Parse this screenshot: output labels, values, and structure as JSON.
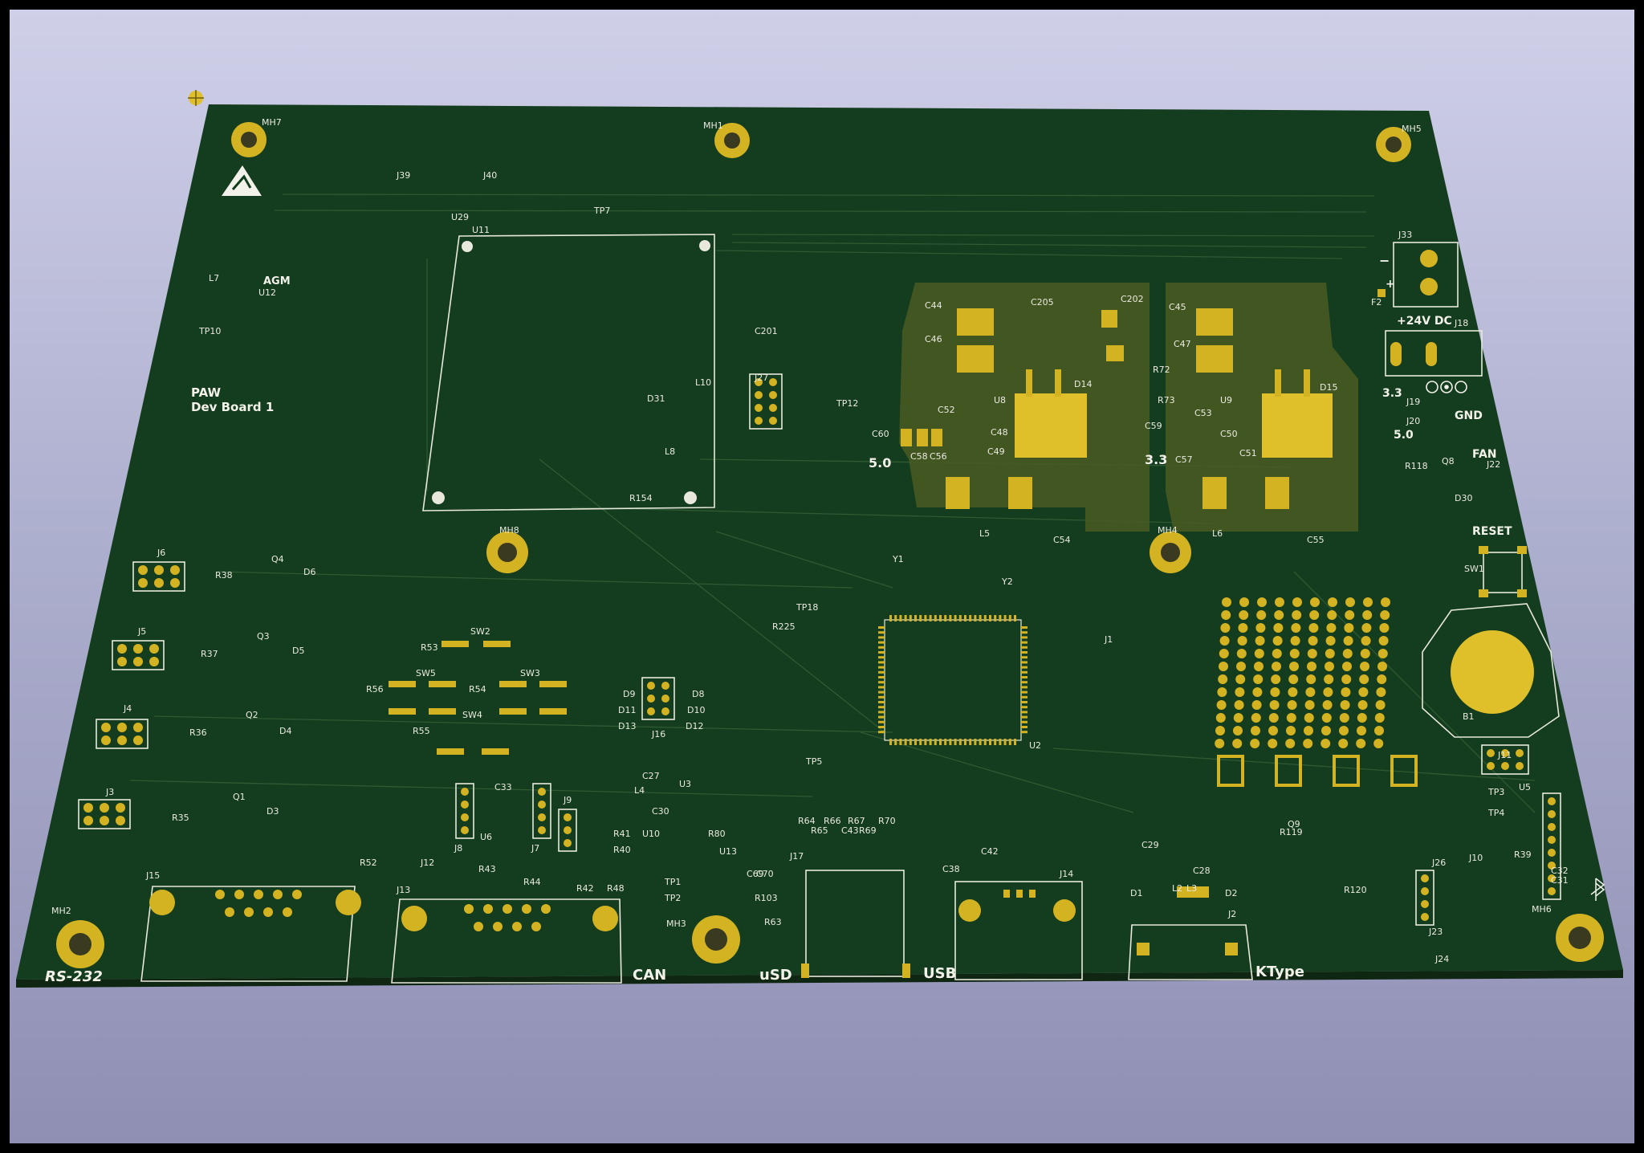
{
  "board": {
    "title": "PAW",
    "subtitle": "Dev Board 1",
    "colors": {
      "solder_mask": "#143c1e",
      "copper_pad": "#d4b323",
      "silkscreen": "#f2f2ea",
      "background_top": "#cfcfe8",
      "background_bottom": "#8f8fb4"
    }
  },
  "edge_labels": {
    "rs232": "RS-232",
    "can": "CAN",
    "usd": "uSD",
    "usb": "USB",
    "ktype": "KType"
  },
  "side_labels": {
    "power_in": "+24V DC",
    "minus": "−",
    "plus": "+",
    "v33": "3.3",
    "gnd": "GND",
    "v50": "5.0",
    "fan": "FAN",
    "reset": "RESET",
    "rail_50": "5.0",
    "rail_33": "3.3",
    "agm": "AGM"
  },
  "mounting_holes": [
    "MH7",
    "MH1",
    "MH5",
    "MH8",
    "MH4",
    "MH2",
    "MH3",
    "MH6"
  ],
  "connectors": [
    "J15",
    "J13",
    "J12",
    "J17",
    "J14",
    "J2",
    "J23",
    "J24",
    "J26",
    "J10",
    "J11",
    "J3",
    "J4",
    "J5",
    "J6",
    "J8",
    "J7",
    "J9",
    "J16",
    "J27",
    "J33",
    "J18",
    "J19",
    "J20",
    "J22",
    "J1",
    "J39",
    "J40"
  ],
  "ics": [
    "U11",
    "U2",
    "U3",
    "U5",
    "U6",
    "U8",
    "U9",
    "U10",
    "U12",
    "U13",
    "U29",
    "B1"
  ],
  "switches": [
    "SW1",
    "SW2",
    "SW3",
    "SW4",
    "SW5"
  ],
  "inductors": [
    "L5",
    "L6",
    "L2",
    "L3",
    "L4",
    "L7",
    "L8",
    "L10"
  ],
  "diodes": [
    "D1",
    "D2",
    "D3",
    "D4",
    "D5",
    "D6",
    "D8",
    "D9",
    "D10",
    "D11",
    "D12",
    "D13",
    "D14",
    "D15",
    "D30",
    "D31"
  ],
  "testpoints": [
    "TP1",
    "TP2",
    "TP3",
    "TP4",
    "TP5",
    "TP7",
    "TP10",
    "TP12",
    "TP18"
  ],
  "crystals": [
    "Y1",
    "Y2"
  ],
  "transistors": [
    "Q1",
    "Q2",
    "Q3",
    "Q4",
    "Q8",
    "Q9"
  ],
  "misc_refs": [
    "F2",
    "C29",
    "C28",
    "C32",
    "C31",
    "C38",
    "C42",
    "C43",
    "C33",
    "C27",
    "C30",
    "C69",
    "C70",
    "C44",
    "C45",
    "C46",
    "C47",
    "C48",
    "C49",
    "C50",
    "C51",
    "C52",
    "C53",
    "C54",
    "C55",
    "C56",
    "C57",
    "C58",
    "C59",
    "C60",
    "C202",
    "C205",
    "C201",
    "R35",
    "R36",
    "R37",
    "R38",
    "R39",
    "R40",
    "R41",
    "R42",
    "R43",
    "R44",
    "R48",
    "R52",
    "R53",
    "R54",
    "R55",
    "R56",
    "R63",
    "R64",
    "R65",
    "R66",
    "R67",
    "R69",
    "R70",
    "R72",
    "R73",
    "R80",
    "R103",
    "R118",
    "R119",
    "R120",
    "R154",
    "R225"
  ]
}
